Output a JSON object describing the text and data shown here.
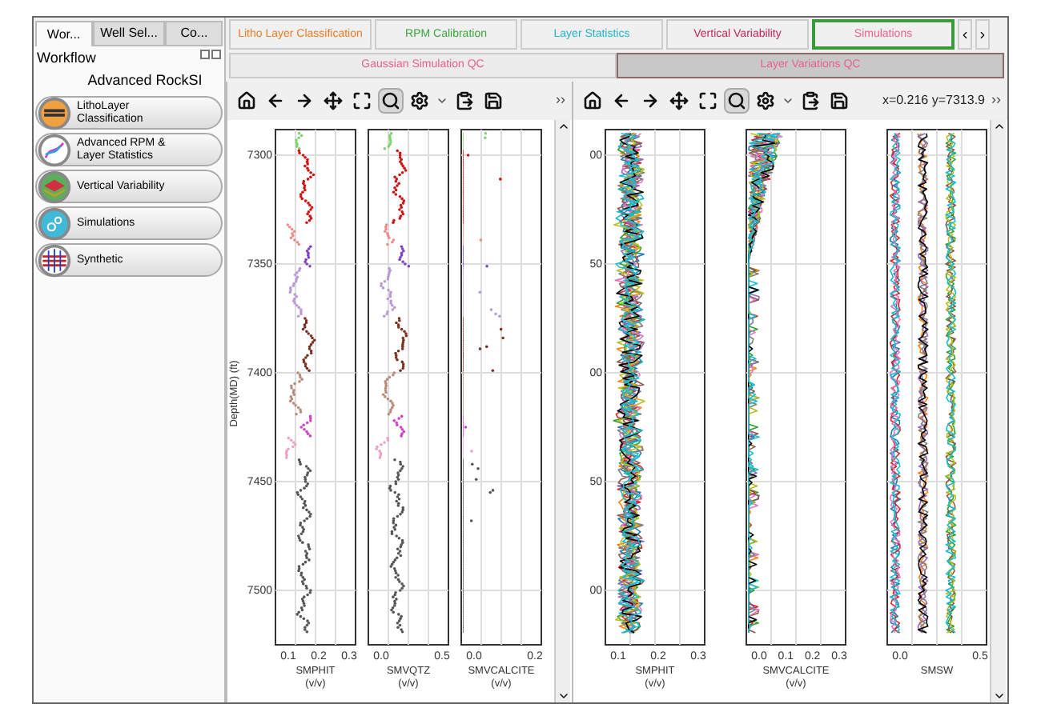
{
  "left_panel": {
    "tabs": [
      {
        "label": "Wor...",
        "selected": true
      },
      {
        "label": "Well Sel...",
        "selected": false
      },
      {
        "label": "Co...",
        "selected": false
      }
    ],
    "title": "Workflow",
    "subtitle": "Advanced RockSI",
    "items": [
      {
        "kind": "litho",
        "label": "LithoLayer Classification"
      },
      {
        "kind": "rpm",
        "label": "Advanced RPM & Layer Statistics"
      },
      {
        "kind": "layers",
        "label": "Vertical Variability"
      },
      {
        "kind": "gears",
        "label": "Simulations"
      },
      {
        "kind": "synthetic",
        "label": "Synthetic"
      }
    ]
  },
  "tabs_row_1": [
    {
      "label": "Litho Layer Classification",
      "color": "#e87b24",
      "selected": false
    },
    {
      "label": "RPM Calibration",
      "color": "#3aa63a",
      "selected": false
    },
    {
      "label": "Layer Statistics",
      "color": "#22b3c9",
      "selected": false
    },
    {
      "label": "Vertical Variability",
      "color": "#c2255c",
      "selected": false
    },
    {
      "label": "Simulations",
      "color": "#e8608a",
      "selected": true
    }
  ],
  "tabs_row_2": [
    {
      "label": "Gaussian Simulation QC",
      "color": "#e8608a",
      "selected": false
    },
    {
      "label": "Layer Variations QC",
      "color": "#e8608a",
      "selected": true
    }
  ],
  "panes": [
    {
      "more": "››",
      "tools": [
        {
          "kind": "home",
          "selected": false
        },
        {
          "kind": "back",
          "selected": false
        },
        {
          "kind": "forward",
          "selected": false
        },
        {
          "kind": "pan",
          "selected": false
        },
        {
          "kind": "fit",
          "selected": false
        },
        {
          "kind": "zoom",
          "selected": true
        },
        {
          "kind": "settings",
          "selected": false
        },
        {
          "kind": "paste",
          "selected": false
        },
        {
          "kind": "save",
          "selected": false
        }
      ],
      "ylabel": "Depth(MD) (ft)",
      "yticks": [
        "7300",
        "7350",
        "7400",
        "7450",
        "7500"
      ],
      "tracks": [
        {
          "kind": "points",
          "label": "SMPHIT",
          "unit": "(v/v)",
          "xticks": [
            "0.1",
            "0.2",
            "0.3"
          ]
        },
        {
          "kind": "points",
          "label": "SMVQTZ",
          "unit": "(v/v)",
          "xticks": [
            "0.0",
            "0.5"
          ]
        },
        {
          "kind": "calcite",
          "label": "SMVCALCITE",
          "unit": "(v/v)",
          "xticks": [
            "0.0",
            "0.2"
          ]
        }
      ]
    },
    {
      "more": "››",
      "coordinates": "x=0.216 y=7313.9",
      "tools": [
        {
          "kind": "home",
          "selected": false
        },
        {
          "kind": "back",
          "selected": false
        },
        {
          "kind": "forward",
          "selected": false
        },
        {
          "kind": "pan",
          "selected": false
        },
        {
          "kind": "fit",
          "selected": false
        },
        {
          "kind": "zoom",
          "selected": true
        },
        {
          "kind": "settings",
          "selected": false
        },
        {
          "kind": "paste",
          "selected": false
        },
        {
          "kind": "save",
          "selected": false
        }
      ],
      "yticks": [
        "00",
        "50",
        "00",
        "50",
        "00"
      ],
      "tracks": [
        {
          "kind": "multi",
          "label": "SMPHIT",
          "unit": "(v/v)",
          "xticks": [
            "0.1",
            "0.2",
            "0.3"
          ]
        },
        {
          "kind": "multi_calcite",
          "label": "SMVCALCITE",
          "unit": "(v/v)",
          "xticks": [
            "0.0",
            "0.1",
            "0.2",
            "0.3"
          ]
        },
        {
          "kind": "multi_sw",
          "label": "SMSW",
          "xticks": [
            "0.0",
            "0.5"
          ]
        }
      ]
    }
  ]
}
